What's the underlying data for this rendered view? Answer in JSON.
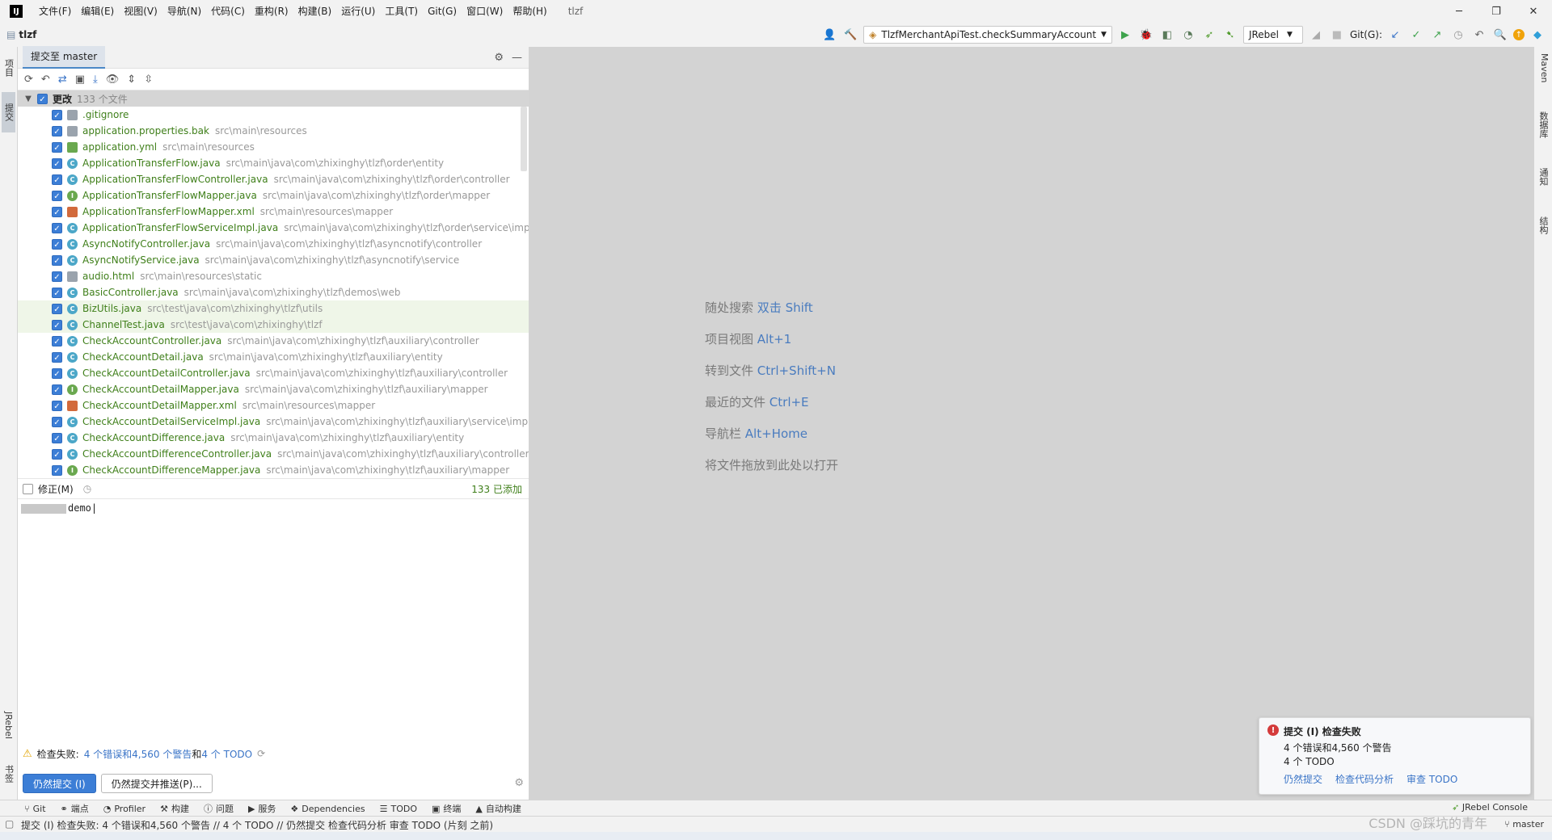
{
  "menubar": {
    "items": [
      "文件(F)",
      "编辑(E)",
      "视图(V)",
      "导航(N)",
      "代码(C)",
      "重构(R)",
      "构建(B)",
      "运行(U)",
      "工具(T)",
      "Git(G)",
      "窗口(W)",
      "帮助(H)"
    ],
    "window_title": "tlzf",
    "logo": "IJ"
  },
  "navbar": {
    "project": "tlzf",
    "run_config": "TlzfMerchantApiTest.checkSummaryAccount",
    "jrebel": "JRebel",
    "git_label": "Git(G):"
  },
  "left_stripe": {
    "project_tab": "项目",
    "commit_tab": "提交",
    "jrebel_tab": "JRebel",
    "bookmarks_tab": "书签"
  },
  "right_stripe": {
    "maven_tab": "Maven",
    "database_tab": "数据库",
    "notifications_tab": "通知",
    "structure_tab": "结构"
  },
  "commit_panel": {
    "tab_title": "提交至 master",
    "changes_label": "更改",
    "changes_count": "133 个文件",
    "files": [
      {
        "name": ".gitignore",
        "path": "",
        "icon": "file"
      },
      {
        "name": "application.properties.bak",
        "path": "src\\main\\resources",
        "icon": "file"
      },
      {
        "name": "application.yml",
        "path": "src\\main\\resources",
        "icon": "yml"
      },
      {
        "name": "ApplicationTransferFlow.java",
        "path": "src\\main\\java\\com\\zhixinghy\\tlzf\\order\\entity",
        "icon": "class"
      },
      {
        "name": "ApplicationTransferFlowController.java",
        "path": "src\\main\\java\\com\\zhixinghy\\tlzf\\order\\controller",
        "icon": "class"
      },
      {
        "name": "ApplicationTransferFlowMapper.java",
        "path": "src\\main\\java\\com\\zhixinghy\\tlzf\\order\\mapper",
        "icon": "iface"
      },
      {
        "name": "ApplicationTransferFlowMapper.xml",
        "path": "src\\main\\resources\\mapper",
        "icon": "xml"
      },
      {
        "name": "ApplicationTransferFlowServiceImpl.java",
        "path": "src\\main\\java\\com\\zhixinghy\\tlzf\\order\\service\\impl",
        "icon": "class"
      },
      {
        "name": "AsyncNotifyController.java",
        "path": "src\\main\\java\\com\\zhixinghy\\tlzf\\asyncnotify\\controller",
        "icon": "class"
      },
      {
        "name": "AsyncNotifyService.java",
        "path": "src\\main\\java\\com\\zhixinghy\\tlzf\\asyncnotify\\service",
        "icon": "class"
      },
      {
        "name": "audio.html",
        "path": "src\\main\\resources\\static",
        "icon": "file"
      },
      {
        "name": "BasicController.java",
        "path": "src\\main\\java\\com\\zhixinghy\\tlzf\\demos\\web",
        "icon": "class"
      },
      {
        "name": "BizUtils.java",
        "path": "src\\test\\java\\com\\zhixinghy\\tlzf\\utils",
        "icon": "class"
      },
      {
        "name": "ChannelTest.java",
        "path": "src\\test\\java\\com\\zhixinghy\\tlzf",
        "icon": "class"
      },
      {
        "name": "CheckAccountController.java",
        "path": "src\\main\\java\\com\\zhixinghy\\tlzf\\auxiliary\\controller",
        "icon": "class"
      },
      {
        "name": "CheckAccountDetail.java",
        "path": "src\\main\\java\\com\\zhixinghy\\tlzf\\auxiliary\\entity",
        "icon": "class"
      },
      {
        "name": "CheckAccountDetailController.java",
        "path": "src\\main\\java\\com\\zhixinghy\\tlzf\\auxiliary\\controller",
        "icon": "class"
      },
      {
        "name": "CheckAccountDetailMapper.java",
        "path": "src\\main\\java\\com\\zhixinghy\\tlzf\\auxiliary\\mapper",
        "icon": "iface"
      },
      {
        "name": "CheckAccountDetailMapper.xml",
        "path": "src\\main\\resources\\mapper",
        "icon": "xml"
      },
      {
        "name": "CheckAccountDetailServiceImpl.java",
        "path": "src\\main\\java\\com\\zhixinghy\\tlzf\\auxiliary\\service\\impl",
        "icon": "class"
      },
      {
        "name": "CheckAccountDifference.java",
        "path": "src\\main\\java\\com\\zhixinghy\\tlzf\\auxiliary\\entity",
        "icon": "class"
      },
      {
        "name": "CheckAccountDifferenceController.java",
        "path": "src\\main\\java\\com\\zhixinghy\\tlzf\\auxiliary\\controller",
        "icon": "class"
      },
      {
        "name": "CheckAccountDifferenceMapper.java",
        "path": "src\\main\\java\\com\\zhixinghy\\tlzf\\auxiliary\\mapper",
        "icon": "iface"
      }
    ],
    "amend_label": "修正(M)",
    "added_count": "133 已添加",
    "commit_message": "demo",
    "inspection": {
      "label": "检查失败:",
      "errors_link": "4 个错误和4,560 个警告",
      "and": "和",
      "todo_link": "4 个 TODO"
    },
    "commit_anyway_button": "仍然提交 (I)",
    "commit_push_button": "仍然提交并推送(P)..."
  },
  "editor_hints": [
    {
      "text": "随处搜索",
      "key": "双击 Shift"
    },
    {
      "text": "项目视图",
      "key": "Alt+1"
    },
    {
      "text": "转到文件",
      "key": "Ctrl+Shift+N"
    },
    {
      "text": "最近的文件",
      "key": "Ctrl+E"
    },
    {
      "text": "导航栏",
      "key": "Alt+Home"
    },
    {
      "text": "将文件拖放到此处以打开",
      "key": ""
    }
  ],
  "notification": {
    "title": "提交 (I) 检查失败",
    "line1": "4 个错误和4,560 个警告",
    "line2": "4 个 TODO",
    "actions": [
      "仍然提交",
      "检查代码分析",
      "审查 TODO"
    ]
  },
  "bottom_bar": {
    "items": [
      "Git",
      "端点",
      "Profiler",
      "构建",
      "问题",
      "服务",
      "Dependencies",
      "TODO",
      "终端",
      "自动构建"
    ],
    "jrebel_console": "JRebel Console"
  },
  "status_bar": {
    "text": "提交 (I) 检查失败: 4 个错误和4,560 个警告 // 4 个 TODO // 仍然提交   检查代码分析   审查 TODO (片刻 之前)",
    "branch": "master"
  },
  "watermark": "CSDN @踩坑的青年"
}
